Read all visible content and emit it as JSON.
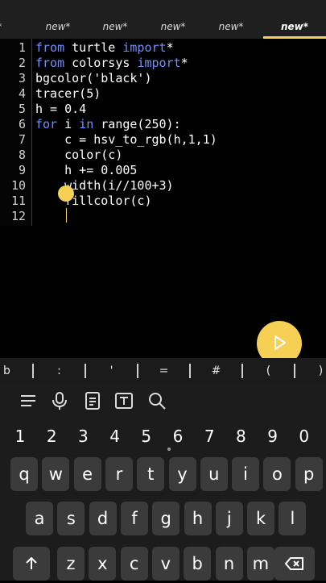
{
  "tabs": [
    {
      "label": "y*",
      "active": false
    },
    {
      "label": "new*",
      "active": false
    },
    {
      "label": "new*",
      "active": false
    },
    {
      "label": "new*",
      "active": false
    },
    {
      "label": "new*",
      "active": false
    },
    {
      "label": "new*",
      "active": true
    }
  ],
  "code_lines": [
    {
      "num": "1",
      "segments": [
        [
          "kw",
          "from"
        ],
        [
          "t",
          " turtle "
        ],
        [
          "kw",
          "import"
        ],
        [
          "t",
          "*"
        ]
      ]
    },
    {
      "num": "2",
      "segments": [
        [
          "kw",
          "from"
        ],
        [
          "t",
          " colorsys "
        ],
        [
          "kw",
          "import"
        ],
        [
          "t",
          "*"
        ]
      ]
    },
    {
      "num": "3",
      "segments": [
        [
          "t",
          "bgcolor('black')"
        ]
      ]
    },
    {
      "num": "4",
      "segments": [
        [
          "t",
          "tracer(5)"
        ]
      ]
    },
    {
      "num": "5",
      "segments": [
        [
          "t",
          "h = 0.4"
        ]
      ]
    },
    {
      "num": "6",
      "segments": [
        [
          "kw",
          "for"
        ],
        [
          "t",
          " i "
        ],
        [
          "kw",
          "in"
        ],
        [
          "t",
          " range(250):"
        ]
      ]
    },
    {
      "num": "7",
      "segments": [
        [
          "t",
          "    c = hsv_to_rgb(h,1,1)"
        ]
      ]
    },
    {
      "num": "8",
      "segments": [
        [
          "t",
          "    color(c)"
        ]
      ]
    },
    {
      "num": "9",
      "segments": [
        [
          "t",
          "    h += 0.005"
        ]
      ]
    },
    {
      "num": "10",
      "segments": [
        [
          "t",
          "    width(i//100+3)"
        ]
      ]
    },
    {
      "num": "11",
      "segments": [
        [
          "t",
          "    fillcolor(c)"
        ]
      ]
    },
    {
      "num": "12",
      "segments": [
        [
          "t",
          ""
        ]
      ]
    }
  ],
  "symbol_bar": [
    "b",
    ":",
    "'",
    "=",
    "#",
    "(",
    ")"
  ],
  "toolbar_icons": [
    "menu-icon",
    "microphone-icon",
    "clipboard-icon",
    "text-icon",
    "search-icon"
  ],
  "number_row": [
    "1",
    "2",
    "3",
    "4",
    "5",
    "6",
    "7",
    "8",
    "9",
    "0"
  ],
  "row1": [
    "q",
    "w",
    "e",
    "r",
    "t",
    "y",
    "u",
    "i",
    "o",
    "p"
  ],
  "row2": [
    "a",
    "s",
    "d",
    "f",
    "g",
    "h",
    "j",
    "k",
    "l"
  ],
  "row3": [
    "z",
    "x",
    "c",
    "v",
    "b",
    "n",
    "m"
  ],
  "colors": {
    "accent": "#f6cf55",
    "keyword": "#6f8fff",
    "key_bg": "#3b3b3b"
  }
}
